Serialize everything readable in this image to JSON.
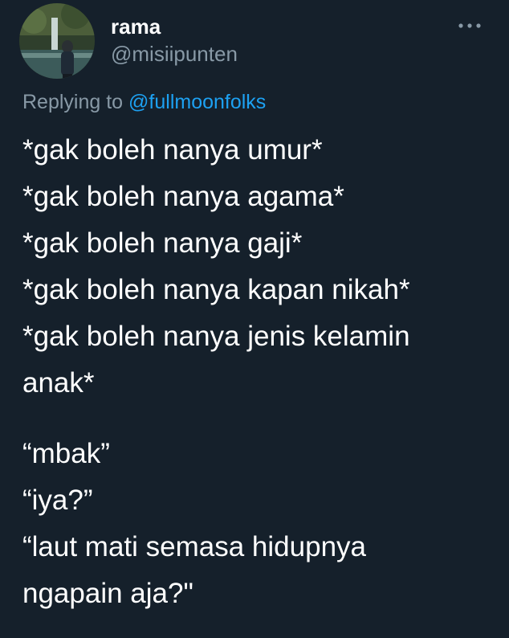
{
  "tweet": {
    "author": {
      "display_name": "rama",
      "handle": "@misiipunten",
      "avatar": "avatar-photo-waterfall-person"
    },
    "more_icon": "more-horizontal-icon",
    "replying": {
      "prefix": "Replying to",
      "mention": "@fullmoonfolks"
    },
    "lines": [
      "*gak boleh nanya umur*",
      "*gak boleh nanya agama*",
      "*gak boleh nanya gaji*",
      "*gak boleh nanya kapan nikah*",
      "*gak boleh nanya jenis kelamin",
      "anak*",
      "“mbak”",
      "“iya?”",
      "“laut mati semasa hidupnya",
      "ngapain aja?\""
    ]
  },
  "colors": {
    "background": "#15202b",
    "text_primary": "#ffffff",
    "text_secondary": "#8899a6",
    "link": "#1da1f2"
  }
}
